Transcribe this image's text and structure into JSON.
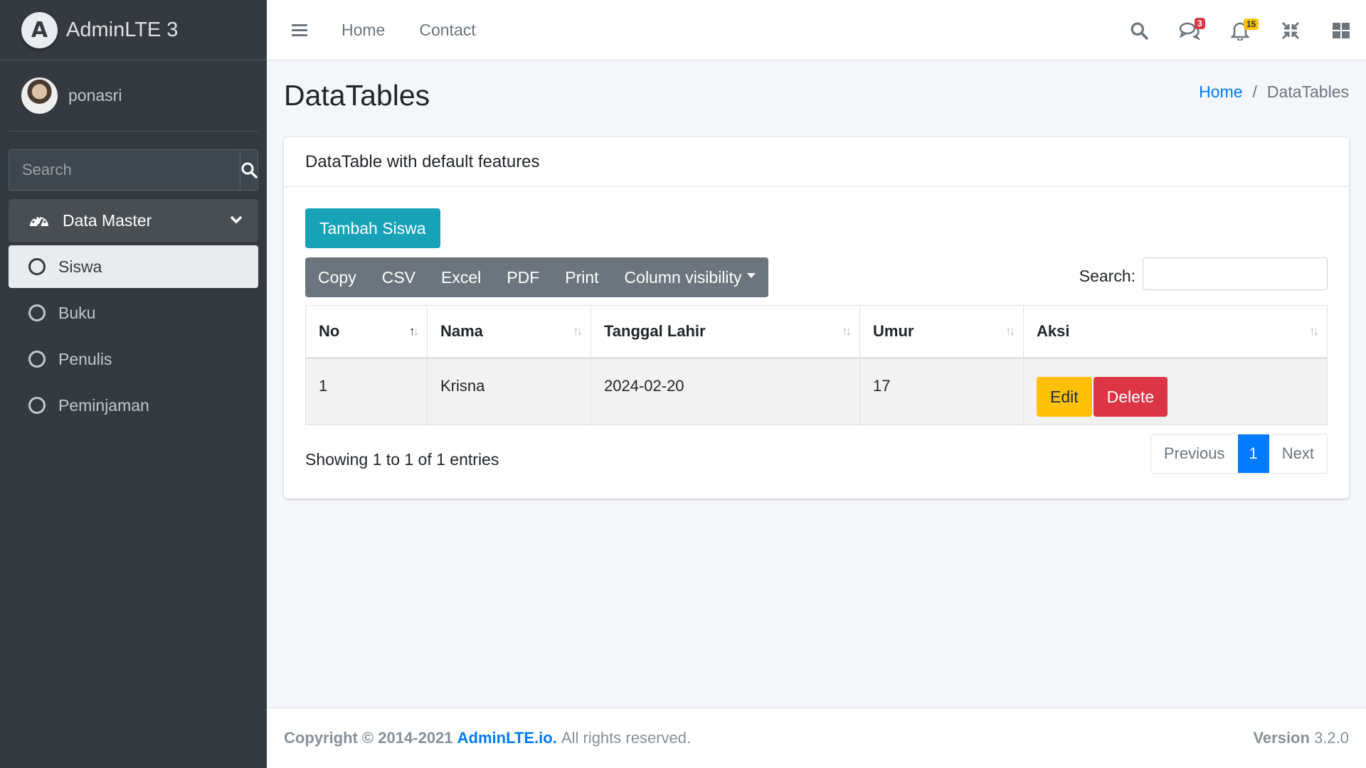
{
  "sidebar": {
    "brand": "AdminLTE 3",
    "logo_letter": "A",
    "user": "ponasri",
    "search_placeholder": "Search",
    "menu_group": "Data Master",
    "items": [
      {
        "label": "Siswa"
      },
      {
        "label": "Buku"
      },
      {
        "label": "Penulis"
      },
      {
        "label": "Peminjaman"
      }
    ]
  },
  "topbar": {
    "links": [
      "Home",
      "Contact"
    ],
    "messages_count": "3",
    "notifications_count": "15"
  },
  "page": {
    "title": "DataTables",
    "breadcrumb": {
      "home": "Home",
      "current": "DataTables"
    }
  },
  "card": {
    "title": "DataTable with default features",
    "add_button": "Tambah Siswa",
    "export_buttons": [
      "Copy",
      "CSV",
      "Excel",
      "PDF",
      "Print",
      "Column visibility"
    ],
    "search_label": "Search:",
    "columns": [
      "No",
      "Nama",
      "Tanggal Lahir",
      "Umur",
      "Aksi"
    ],
    "rows": [
      {
        "no": "1",
        "nama": "Krisna",
        "tanggal_lahir": "2024-02-20",
        "umur": "17"
      }
    ],
    "edit_label": "Edit",
    "delete_label": "Delete",
    "info": "Showing 1 to 1 of 1 entries",
    "pagination": {
      "previous": "Previous",
      "current": "1",
      "next": "Next"
    }
  },
  "footer": {
    "copyright": "Copyright © 2014-2021",
    "brand_link": "AdminLTE.io.",
    "rights": "All rights reserved.",
    "version_label": "Version",
    "version": "3.2.0"
  },
  "colors": {
    "sidebar_bg": "#343a40",
    "primary": "#007bff",
    "info": "#17a2b8",
    "warning": "#ffc107",
    "danger": "#dc3545",
    "secondary": "#6c757d"
  }
}
